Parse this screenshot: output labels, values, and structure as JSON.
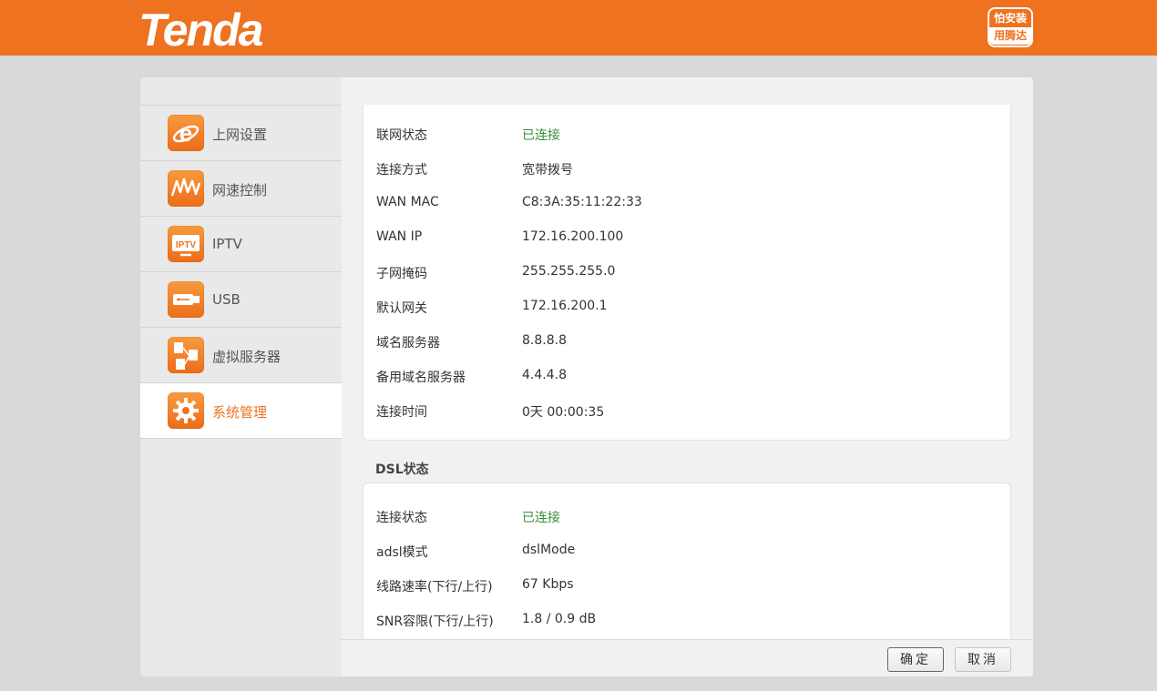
{
  "header": {
    "logo": "Tenda",
    "badge_line1": "怕安装",
    "badge_line2": "用腾达"
  },
  "sidebar": {
    "items": [
      {
        "label": "上网设置",
        "icon": "internet-e-icon"
      },
      {
        "label": "网速控制",
        "icon": "speed-wave-icon"
      },
      {
        "label": "IPTV",
        "icon": "iptv-icon"
      },
      {
        "label": "USB",
        "icon": "usb-icon"
      },
      {
        "label": "虚拟服务器",
        "icon": "virtual-server-icon"
      },
      {
        "label": "系统管理",
        "icon": "gear-icon",
        "active": true
      }
    ]
  },
  "wan": {
    "rows": [
      {
        "key": "联网状态",
        "value": "已连接",
        "status": true
      },
      {
        "key": "连接方式",
        "value": "宽带拨号"
      },
      {
        "key": "WAN MAC",
        "value": "C8:3A:35:11:22:33"
      },
      {
        "key": "WAN IP",
        "value": "172.16.200.100"
      },
      {
        "key": "子网掩码",
        "value": "255.255.255.0"
      },
      {
        "key": "默认网关",
        "value": "172.16.200.1"
      },
      {
        "key": "域名服务器",
        "value": "8.8.8.8"
      },
      {
        "key": "备用域名服务器",
        "value": "4.4.4.8"
      },
      {
        "key": "连接时间",
        "value": "0天 00:00:35"
      }
    ]
  },
  "dsl": {
    "title": "DSL状态",
    "rows": [
      {
        "key": "连接状态",
        "value": "已连接",
        "status": true
      },
      {
        "key": "adsl模式",
        "value": "dslMode"
      },
      {
        "key": "线路速率(下行/上行)",
        "value": "67 Kbps"
      },
      {
        "key": "SNR容限(下行/上行)",
        "value": "1.8 / 0.9 dB"
      }
    ]
  },
  "footer": {
    "ok_label": "确定",
    "cancel_label": "取消"
  },
  "colors": {
    "brand": "#ee7220",
    "status_ok": "#3b8d3b"
  }
}
